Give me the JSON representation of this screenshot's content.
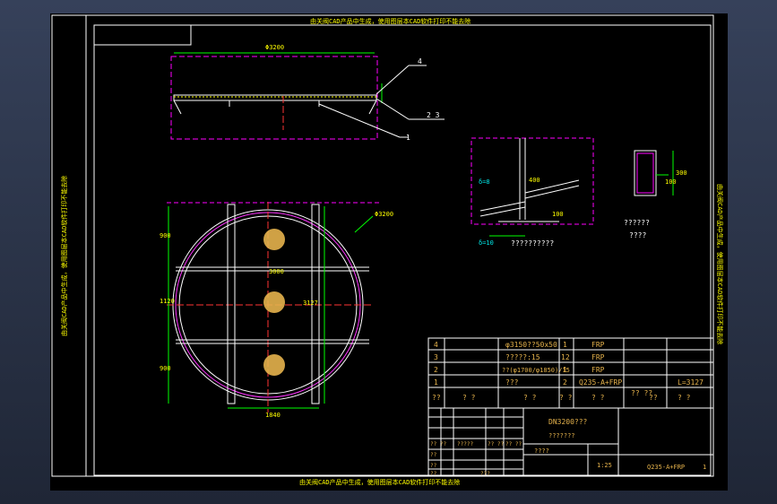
{
  "drawing": {
    "top_note": "由关阀CAD产品中生成，使用图层本CAD软件打印不能去除",
    "bottom_note": "由关阀CAD产品中生成，使用图层本CAD软件打印不能去除",
    "left_note": "由关阀CAD产品中生成，使用图层本CAD软件打印不能去除",
    "right_note": "由关阀CAD产品中生成，使用图层本CAD软件打印不能去除",
    "balloons": {
      "b4": "4",
      "b23": "2  3",
      "b1": "1"
    },
    "detail_labels": {
      "detail_a": "??????????",
      "detail_b_1": "??????",
      "detail_b_2": "????"
    },
    "dims": {
      "top_width": "Φ3200",
      "diameter": "Φ3200",
      "d1": "900",
      "d2": "1120",
      "d3": "900",
      "beam": "3000",
      "beam_h": "3127",
      "bottom_w": "1840",
      "det_h": "300",
      "det_w": "100",
      "det_a1": "δ=8",
      "det_a2": "δ=10",
      "det_a3": "400",
      "det_a4": "100"
    }
  },
  "bom": {
    "rows": [
      {
        "no": "4",
        "spec": "φ3150??50x50",
        "qty": "1",
        "material": "FRP",
        "note": ""
      },
      {
        "no": "3",
        "spec": "?????:15",
        "qty": "12",
        "material": "FRP",
        "note": ""
      },
      {
        "no": "2",
        "spec": "??(φ1700/φ1850)/15",
        "qty": "1",
        "material": "FRP",
        "note": ""
      },
      {
        "no": "1",
        "spec": "???",
        "qty": "2",
        "material": "Q235-A+FRP",
        "note": "L=3127"
      }
    ],
    "header": [
      "??",
      "?  ?",
      "?  ?",
      "?  ?",
      "?  ?",
      "??\n??",
      "??",
      "?  ?"
    ]
  },
  "title_block": {
    "title": "DN3200???",
    "subtitle": "???????",
    "material": "Q235-A+FRP",
    "sheet": "1",
    "scale_label": "????",
    "scale": "1:25",
    "left_cells": [
      "?? ??",
      "?????",
      "?? ??",
      "?? ??",
      "??",
      "??",
      "??",
      "???"
    ]
  }
}
